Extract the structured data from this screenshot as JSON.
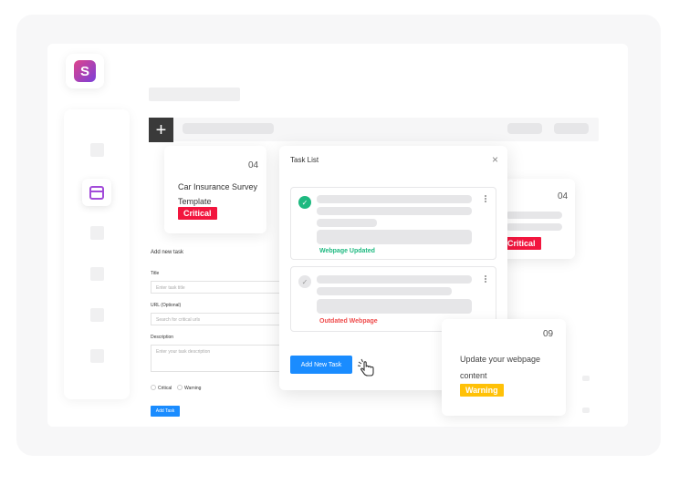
{
  "colors": {
    "critical": "#f2163e",
    "warning": "#ffc107",
    "success": "#1eb980",
    "danger": "#ef4b4b",
    "primary": "#1a8cff",
    "brand": "#a24bd9"
  },
  "logo": {
    "letter": "S",
    "icon": "brand-logo-icon"
  },
  "toolbar": {
    "plus_icon": "plus-icon",
    "plus_label": "+"
  },
  "card_left": {
    "number": "04",
    "title_line1": "Car Insurance Survey",
    "title_line2": "Template",
    "badge": "Critical"
  },
  "card_right": {
    "number": "04",
    "badge": "Critical"
  },
  "card_bottom": {
    "number": "09",
    "title_line1": "Update your webpage",
    "title_line2": "content",
    "badge": "Warning"
  },
  "form": {
    "heading": "Add new task",
    "title_label": "Title",
    "title_placeholder": "Enter task title",
    "url_label": "URL (Optional)",
    "url_placeholder": "Search for critical urls",
    "description_label": "Description",
    "description_placeholder": "Enter your task description",
    "option_critical": "Critical",
    "option_warning": "Warning",
    "submit_label": "Add Task"
  },
  "dialog": {
    "title": "Task List",
    "close_label": "×",
    "tasks": [
      {
        "status": "Webpage Updated",
        "check": "✓"
      },
      {
        "status": "Outdated Webpage",
        "check": "✓"
      }
    ],
    "add_button": "Add New Task"
  }
}
